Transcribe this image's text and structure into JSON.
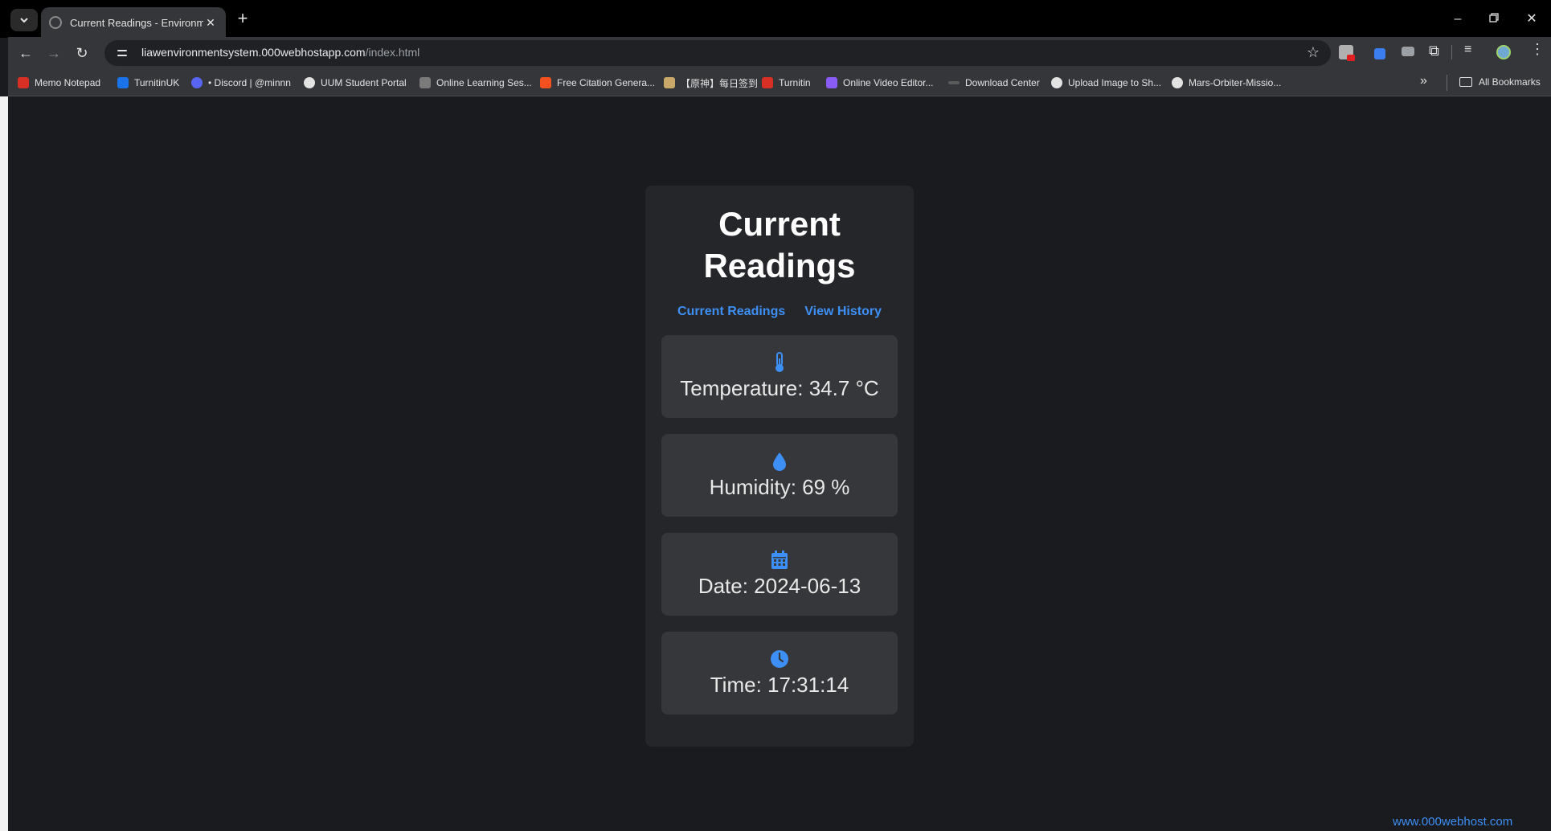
{
  "browser": {
    "tab_title": "Current Readings - Environment",
    "url_host": "liawenvironmentsystem.000webhostapp.com",
    "url_path": "/index.html"
  },
  "bookmarks": [
    {
      "label": "Memo Notepad",
      "color": "#d93025"
    },
    {
      "label": "TurnitinUK",
      "color": "#1a73e8"
    },
    {
      "label": "• Discord | @minnn",
      "color": "#5865f2"
    },
    {
      "label": "UUM Student Portal",
      "color": "#e3e3e3"
    },
    {
      "label": "Online Learning Ses...",
      "color": "#e3e3e3"
    },
    {
      "label": "Free Citation Genera...",
      "color": "#f4511e"
    },
    {
      "label": "【原神】每日签到",
      "color": "#c9a86a"
    },
    {
      "label": "Turnitin",
      "color": "#d93025"
    },
    {
      "label": "Online Video Editor...",
      "color": "#8a5cf6"
    },
    {
      "label": "Download Center",
      "color": "#e3e3e3"
    },
    {
      "label": "Upload Image to Sh...",
      "color": "#e3e3e3"
    },
    {
      "label": "Mars-Orbiter-Missio...",
      "color": "#e3e3e3"
    }
  ],
  "all_bookmarks": "All Bookmarks",
  "page": {
    "heading": "Current Readings",
    "nav": {
      "current": "Current Readings",
      "history": "View History"
    },
    "readings": {
      "temperature": "Temperature: 34.7 °C",
      "humidity": "Humidity: 69 %",
      "date": "Date: 2024-06-13",
      "time": "Time: 17:31:14"
    },
    "corner_link": "www.000webhost.com"
  },
  "colors": {
    "accent": "#3d8ff5",
    "card": "#252629",
    "tile": "#36373b",
    "background": "#1a1b1e"
  }
}
